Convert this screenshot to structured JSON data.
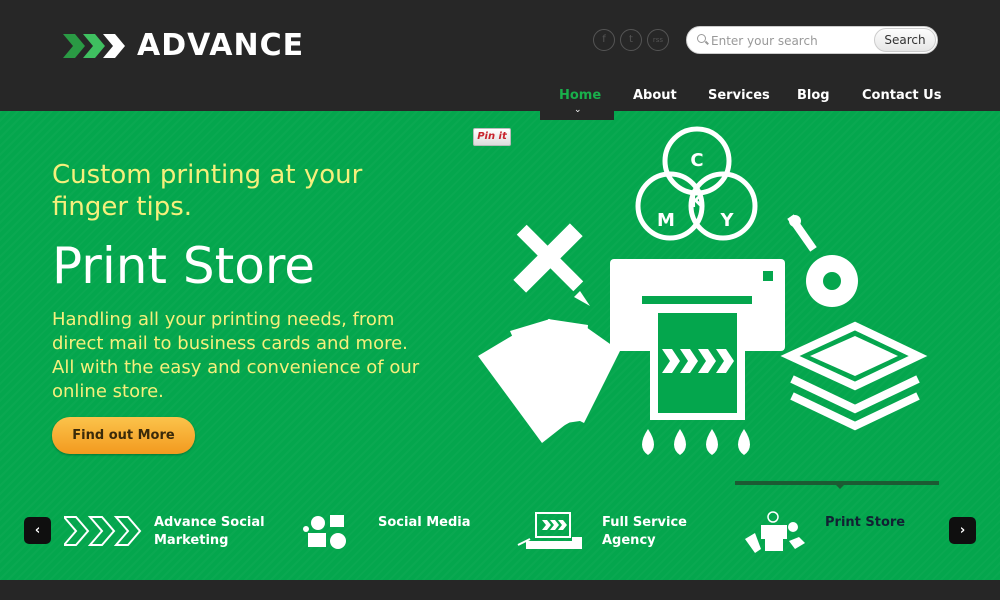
{
  "header": {
    "logo_text": "ADVANCE",
    "search": {
      "placeholder": "Enter your search",
      "button_label": "Search"
    },
    "social": [
      "f",
      "t",
      "rss"
    ],
    "nav": [
      {
        "label": "Home",
        "active": true
      },
      {
        "label": "About"
      },
      {
        "label": "Services"
      },
      {
        "label": "Blog"
      },
      {
        "label": "Contact Us"
      }
    ]
  },
  "hero": {
    "tagline": "Custom printing at your finger tips.",
    "title": "Print Store",
    "description": "Handling all your printing needs, from direct mail to business cards and more. All with the easy and convenience of our online store.",
    "cta_label": "Find out More",
    "pinit_label": "Pin it",
    "cmyk": [
      "C",
      "M",
      "K",
      "Y"
    ]
  },
  "slider": {
    "prev_label": "‹",
    "next_label": "›",
    "items": [
      {
        "label": "Advance Social Marketing"
      },
      {
        "label": "Social Media"
      },
      {
        "label": "Full Service Agency"
      },
      {
        "label": "Print Store",
        "active": true
      }
    ]
  },
  "colors": {
    "brand_green": "#04a64d",
    "accent_yellow": "#f6ef7c",
    "header_bg": "#272727",
    "cta_orange": "#f5a623"
  }
}
